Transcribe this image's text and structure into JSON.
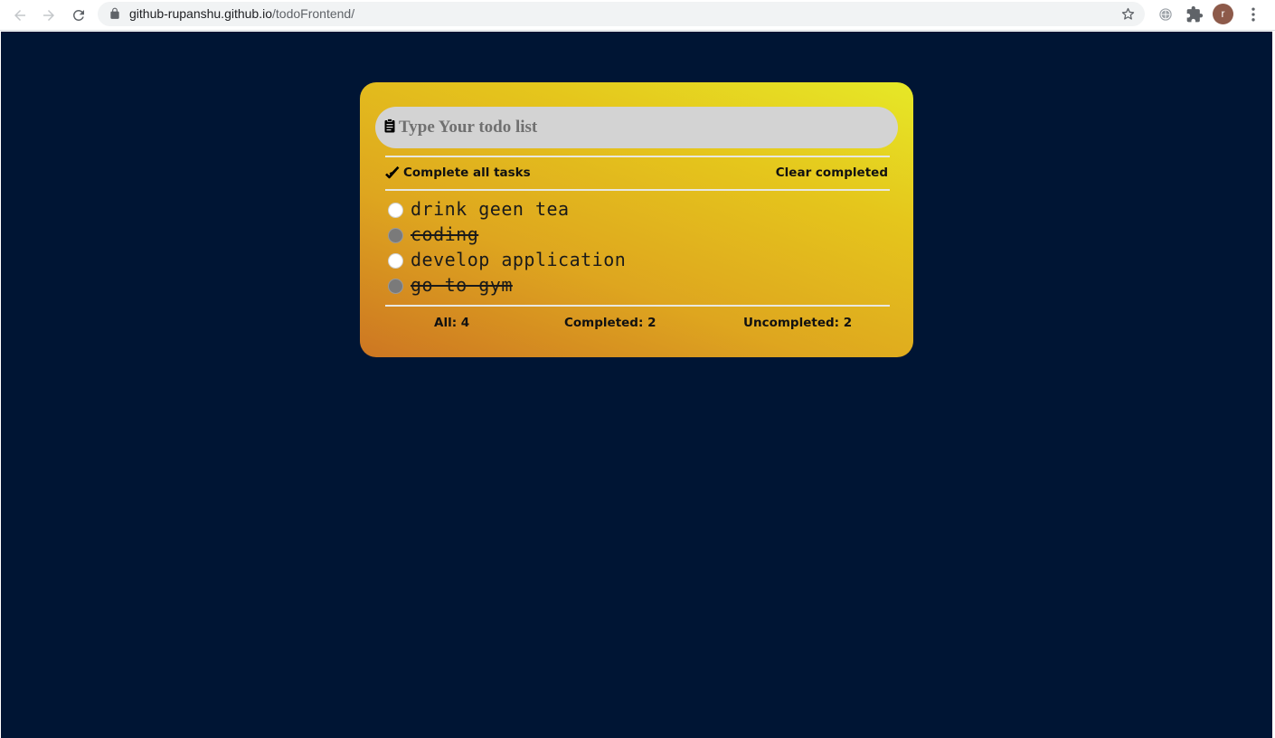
{
  "browser": {
    "url_host": "github-rupanshu.github.io",
    "url_path": "/todoFrontend/",
    "avatar_letter": "r"
  },
  "todo_app": {
    "input_placeholder": "Type Your todo list",
    "complete_all_label": "Complete all tasks",
    "clear_completed_label": "Clear completed",
    "items": [
      {
        "text": "drink geen tea",
        "completed": false
      },
      {
        "text": "coding",
        "completed": true
      },
      {
        "text": "develop application",
        "completed": false
      },
      {
        "text": "go to gym",
        "completed": true
      }
    ],
    "stats": {
      "all": "All: 4",
      "completed": "Completed: 2",
      "uncompleted": "Uncompleted: 2"
    }
  },
  "colors": {
    "page_background": "#001534",
    "card_gradient_top": "#e6e827",
    "card_gradient_bottom": "#cd7622",
    "input_background": "#d3d3d3"
  }
}
